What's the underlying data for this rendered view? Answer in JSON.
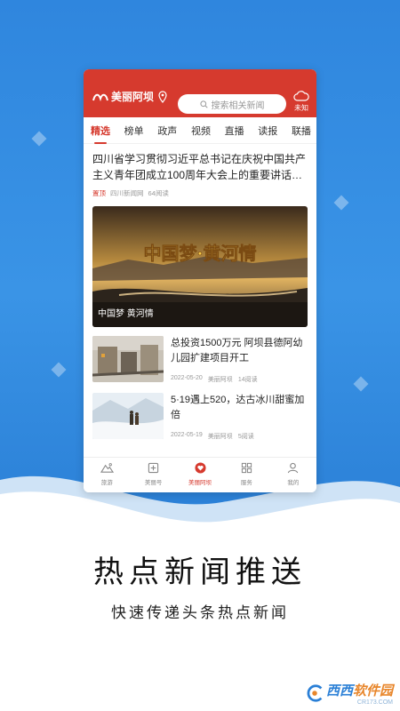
{
  "app": {
    "logo_text": "美丽阿坝",
    "search_placeholder": "搜索相关新闻",
    "weather_label": "未知"
  },
  "tabs": [
    {
      "label": "精选",
      "active": true
    },
    {
      "label": "榜单"
    },
    {
      "label": "政声"
    },
    {
      "label": "视频"
    },
    {
      "label": "直播"
    },
    {
      "label": "读报"
    },
    {
      "label": "联播"
    }
  ],
  "headline": {
    "title": "四川省学习贯彻习近平总书记在庆祝中国共产主义青年团成立100周年大会上的重要讲话…",
    "tag": "置顶",
    "source": "四川新闻网",
    "reads": "64阅读"
  },
  "feature": {
    "banner_text": "中国梦·黄河情",
    "caption": "中国梦 黄河情"
  },
  "news": [
    {
      "title": "总投资1500万元 阿坝县德阿幼儿园扩建项目开工",
      "date": "2022-05-20",
      "source": "美丽阿坝",
      "reads": "14阅读"
    },
    {
      "title": "5·19遇上520，达古冰川甜蜜加倍",
      "date": "2022-05-19",
      "source": "美丽阿坝",
      "reads": "5阅读"
    }
  ],
  "bottom_nav": [
    {
      "label": "旅游",
      "icon": "mountain-icon"
    },
    {
      "label": "美丽号",
      "icon": "plus-box-icon"
    },
    {
      "label": "美丽阿坝",
      "icon": "heart-icon",
      "active": true
    },
    {
      "label": "服务",
      "icon": "grid-icon"
    },
    {
      "label": "我的",
      "icon": "person-icon"
    }
  ],
  "promo": {
    "title": "热点新闻推送",
    "subtitle": "快速传递头条热点新闻"
  },
  "watermark": {
    "brand": "西西",
    "site": "软件园",
    "domain": "CR173.COM"
  },
  "colors": {
    "brand_red": "#d63a2e",
    "bg_blue": "#2f86de"
  }
}
